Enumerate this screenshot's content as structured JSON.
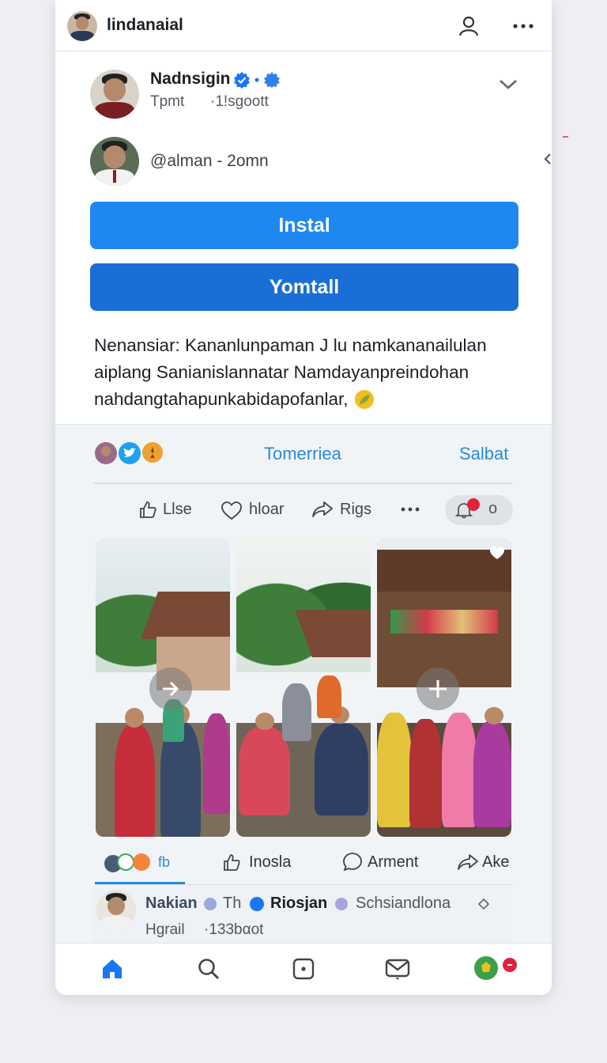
{
  "header": {
    "username": "lindanaial"
  },
  "post": {
    "author_name": "Nadnsigin",
    "author_meta_1": "Tpmt",
    "author_meta_2": "·1!sgoott",
    "reply_handle": "@alman - 2omn",
    "install_label": "Instal",
    "secondary_label": "Yomtall",
    "body_line_1": "Nenansiar: Kananlunpaman J lu namkananailulan",
    "body_line_2": "aiplang Sanianislannatar Namdayanpreindohan",
    "body_line_3": "nahdangtahapunkabidapofanlar,"
  },
  "feed": {
    "tab_center": "Tomerriea",
    "tab_right": "Salbat",
    "actions": {
      "like": "Llse",
      "love": "hloar",
      "share": "Rigs",
      "notif_count": "o"
    },
    "footer_actions": {
      "reaction_count": "fb",
      "insight": "Inosla",
      "comment": "Arment",
      "share": "Ake"
    },
    "comment": {
      "name_1": "Nakian",
      "name_2": "Th",
      "name_3": "Riosjan",
      "name_4": "Schsiandlona",
      "meta_1": "Hgrail",
      "meta_2": "·133bαot"
    }
  },
  "colors": {
    "brand_blue": "#1877f2",
    "button_primary": "#1e88f0",
    "button_secondary": "#1a6fd6",
    "link_blue": "#2a8bd8",
    "notification_red": "#e0233a"
  },
  "icons": [
    "profile-icon",
    "more-icon",
    "verified-icon",
    "chevron-down-icon",
    "like-icon",
    "heart-icon",
    "share-icon",
    "notification-bell-icon",
    "arrow-right-icon",
    "plus-icon",
    "home-icon",
    "search-icon",
    "square-icon",
    "mail-icon"
  ]
}
